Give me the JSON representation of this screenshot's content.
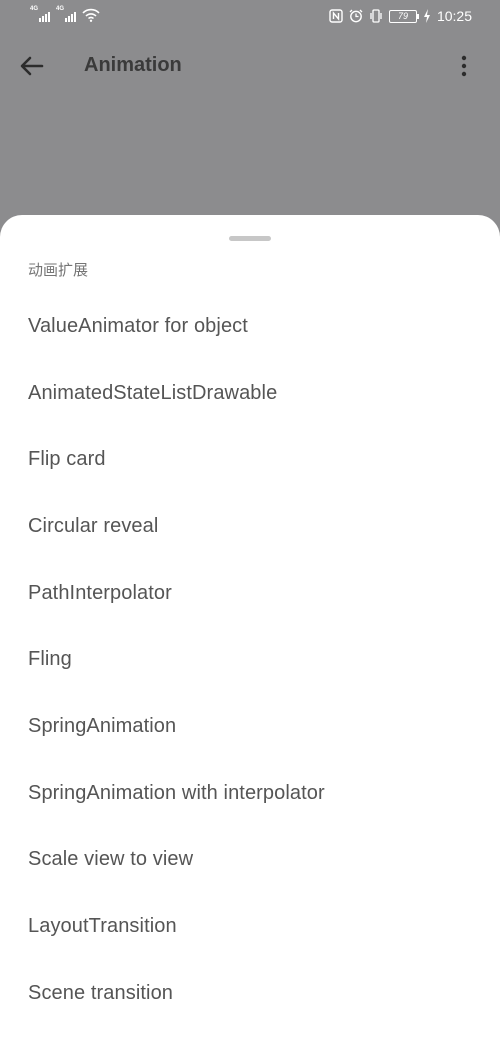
{
  "status_bar": {
    "network_1": "4G",
    "network_2": "4G",
    "battery": "79",
    "time": "10:25",
    "icons": [
      "signal-icon",
      "signal-icon",
      "wifi-icon",
      "nfc-icon",
      "alarm-icon",
      "vibrate-icon",
      "battery-icon",
      "charging-icon"
    ]
  },
  "toolbar": {
    "title": "Animation",
    "back_icon": "arrow-back-icon",
    "more_icon": "more-vert-icon"
  },
  "sheet": {
    "header": "动画扩展",
    "items": [
      {
        "label": "ValueAnimator for object"
      },
      {
        "label": "AnimatedStateListDrawable"
      },
      {
        "label": "Flip card"
      },
      {
        "label": "Circular reveal"
      },
      {
        "label": "PathInterpolator"
      },
      {
        "label": "Fling"
      },
      {
        "label": "SpringAnimation"
      },
      {
        "label": "SpringAnimation with interpolator"
      },
      {
        "label": "Scale view to view"
      },
      {
        "label": "LayoutTransition"
      },
      {
        "label": "Scene transition"
      }
    ]
  },
  "colors": {
    "scrim": "#8c8c8e",
    "sheet_background": "#ffffff",
    "item_text": "#555555",
    "header_text": "#757575",
    "title_text": "#3a3a3a"
  }
}
